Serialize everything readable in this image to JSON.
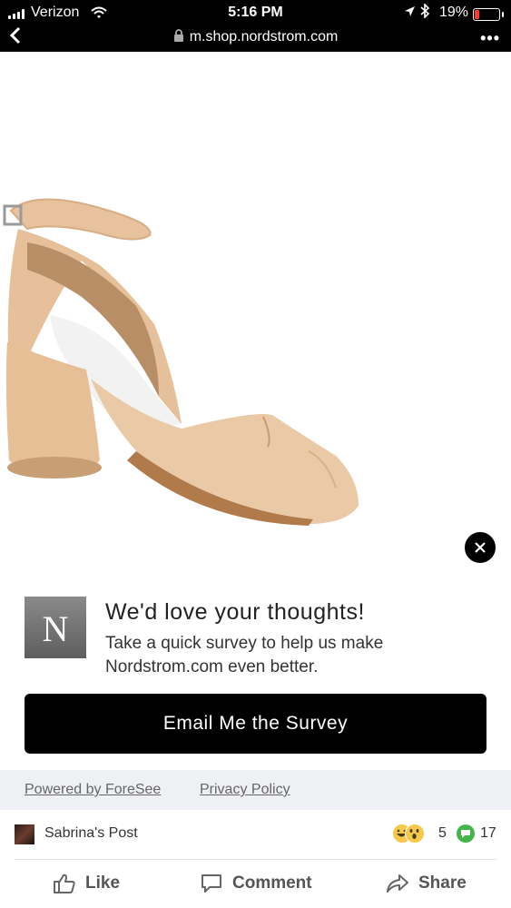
{
  "status_bar": {
    "carrier": "Verizon",
    "time": "5:16 PM",
    "battery": "19%",
    "battery_level": 0.19,
    "icons": [
      "signal-icon",
      "wifi-icon",
      "location-icon",
      "bluetooth-icon",
      "battery-icon"
    ]
  },
  "browser": {
    "url": "m.shop.nordstrom.com",
    "more": "•••"
  },
  "survey": {
    "logo_letter": "N",
    "title": "We'd love your thoughts!",
    "body": "Take a quick survey to help us make Nordstrom.com even better.",
    "button": "Email Me the Survey",
    "powered_by": "Powered by ForeSee",
    "privacy": "Privacy Policy"
  },
  "post": {
    "name": "Sabrina's Post",
    "reactions_count": "5",
    "comments_count": "17",
    "actions": {
      "like": "Like",
      "comment": "Comment",
      "share": "Share"
    }
  },
  "colors": {
    "bar": "#000000",
    "footer_bg": "#eef0f4",
    "shoe": "#e8c4a0",
    "comment_badge": "#44b549",
    "battery_low": "#ff3b30"
  }
}
